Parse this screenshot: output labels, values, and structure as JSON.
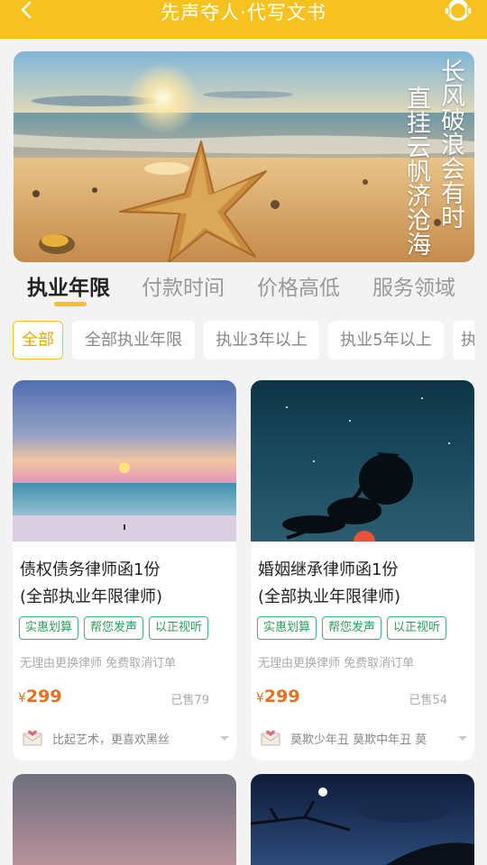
{
  "header": {
    "title": "先声夺人·代写文书",
    "color": "#f7c220"
  },
  "banner": {
    "poem_line1": "长风破浪会有时",
    "poem_line2": "直挂云帆济沧海"
  },
  "tabs": [
    {
      "label": "执业年限",
      "active": true
    },
    {
      "label": "付款时间",
      "active": false
    },
    {
      "label": "价格高低",
      "active": false
    },
    {
      "label": "服务领域",
      "active": false
    }
  ],
  "chips": [
    {
      "label": "全部",
      "active": true
    },
    {
      "label": "全部执业年限",
      "active": false
    },
    {
      "label": "执业3年以上",
      "active": false
    },
    {
      "label": "执业5年以上",
      "active": false
    },
    {
      "label": "执",
      "active": false
    }
  ],
  "products": [
    {
      "title_line1": "债权债务律师函1份",
      "title_line2": "(全部执业年限律师)",
      "tags": [
        "实惠划算",
        "帮您发声",
        "以正视听"
      ],
      "note": "无理由更换律师 免费取消订单",
      "currency": "¥",
      "price": "299",
      "sold": "已售79",
      "seller": "比起艺术，更喜欢黑丝"
    },
    {
      "title_line1": "婚姻继承律师函1份",
      "title_line2": "(全部执业年限律师)",
      "tags": [
        "实惠划算",
        "帮您发声",
        "以正视听"
      ],
      "note": "无理由更换律师 免费取消订单",
      "currency": "¥",
      "price": "299",
      "sold": "已售54",
      "seller": "莫欺少年丑 莫欺中年丑 莫"
    }
  ],
  "colors": {
    "accent": "#f7c220",
    "price": "#e8701e",
    "tag": "#3cb371"
  },
  "icons": [
    "back-chevron-icon",
    "customer-service-icon",
    "love-letter-icon",
    "dropdown-caret-icon"
  ]
}
